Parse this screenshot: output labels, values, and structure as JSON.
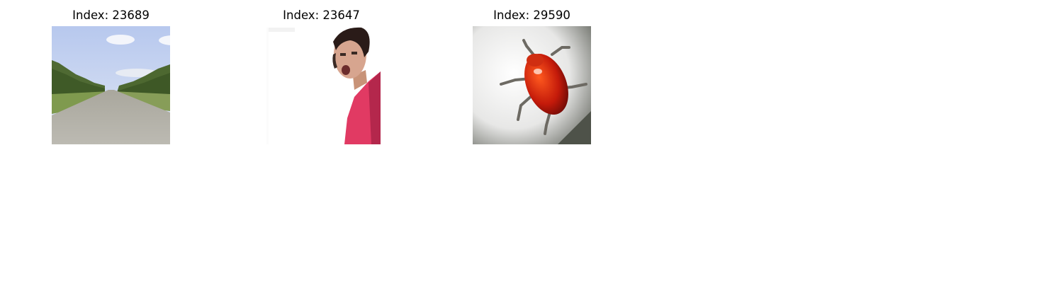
{
  "panels": [
    {
      "title": "Index: 23689",
      "image": "road-landscape-thumbnail"
    },
    {
      "title": "Index: 23647",
      "image": "person-portrait-thumbnail"
    },
    {
      "title": "Index: 29590",
      "image": "red-beetle-thumbnail"
    }
  ]
}
